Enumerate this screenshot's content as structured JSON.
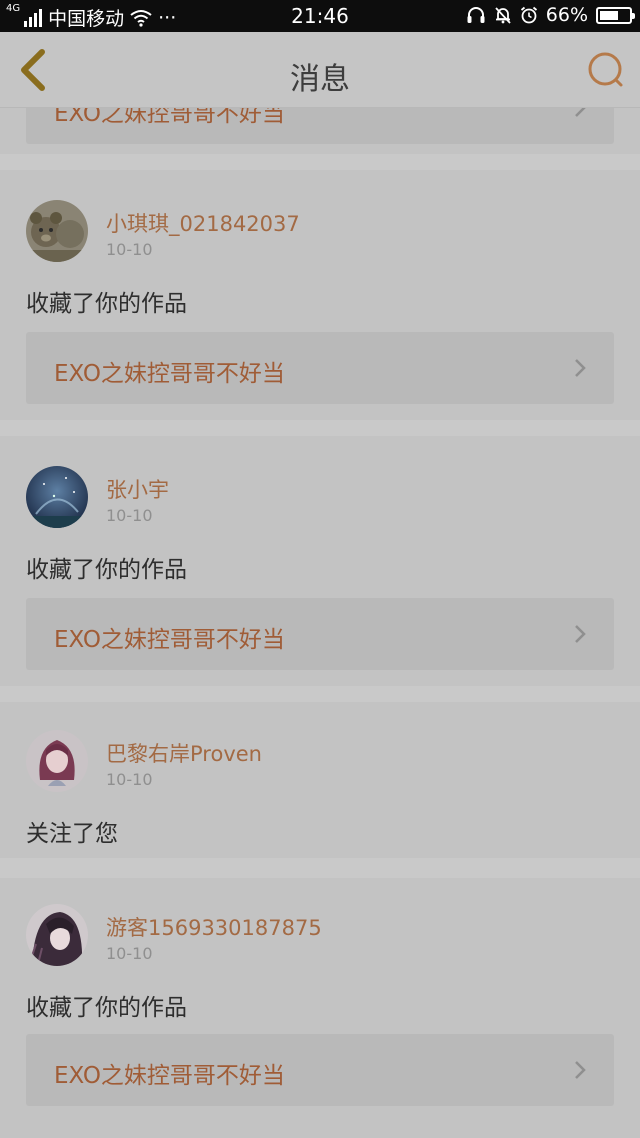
{
  "status_bar": {
    "network": "4G",
    "carrier": "中国移动",
    "more": "···",
    "time": "21:46",
    "battery": "66%",
    "battery_level": 0.66
  },
  "header": {
    "title": "消息"
  },
  "top_partial": {
    "work_title": "EXO之妹控哥哥不好当"
  },
  "messages": [
    {
      "user": "小琪琪_021842037",
      "date": "10-10",
      "action": "收藏了你的作品",
      "work_title": "EXO之妹控哥哥不好当"
    },
    {
      "user": "张小宇",
      "date": "10-10",
      "action": "收藏了你的作品",
      "work_title": "EXO之妹控哥哥不好当"
    },
    {
      "user": "巴黎右岸Proven",
      "date": "10-10",
      "action": "关注了您"
    },
    {
      "user": "游客1569330187875",
      "date": "10-10",
      "action": "收藏了你的作品",
      "work_title": "EXO之妹控哥哥不好当"
    }
  ],
  "colors": {
    "overlay_bg": "#c9c9c9",
    "username": "#a36a44",
    "work_title": "#a05c36",
    "back_icon": "#8a6d1e",
    "search_icon": "#b57a4a"
  },
  "icons": [
    "back-chevron-icon",
    "search-icon",
    "chevron-right-icon",
    "signal-icon",
    "wifi-icon",
    "headset-icon",
    "mute-bell-icon",
    "alarm-icon",
    "battery-icon"
  ]
}
